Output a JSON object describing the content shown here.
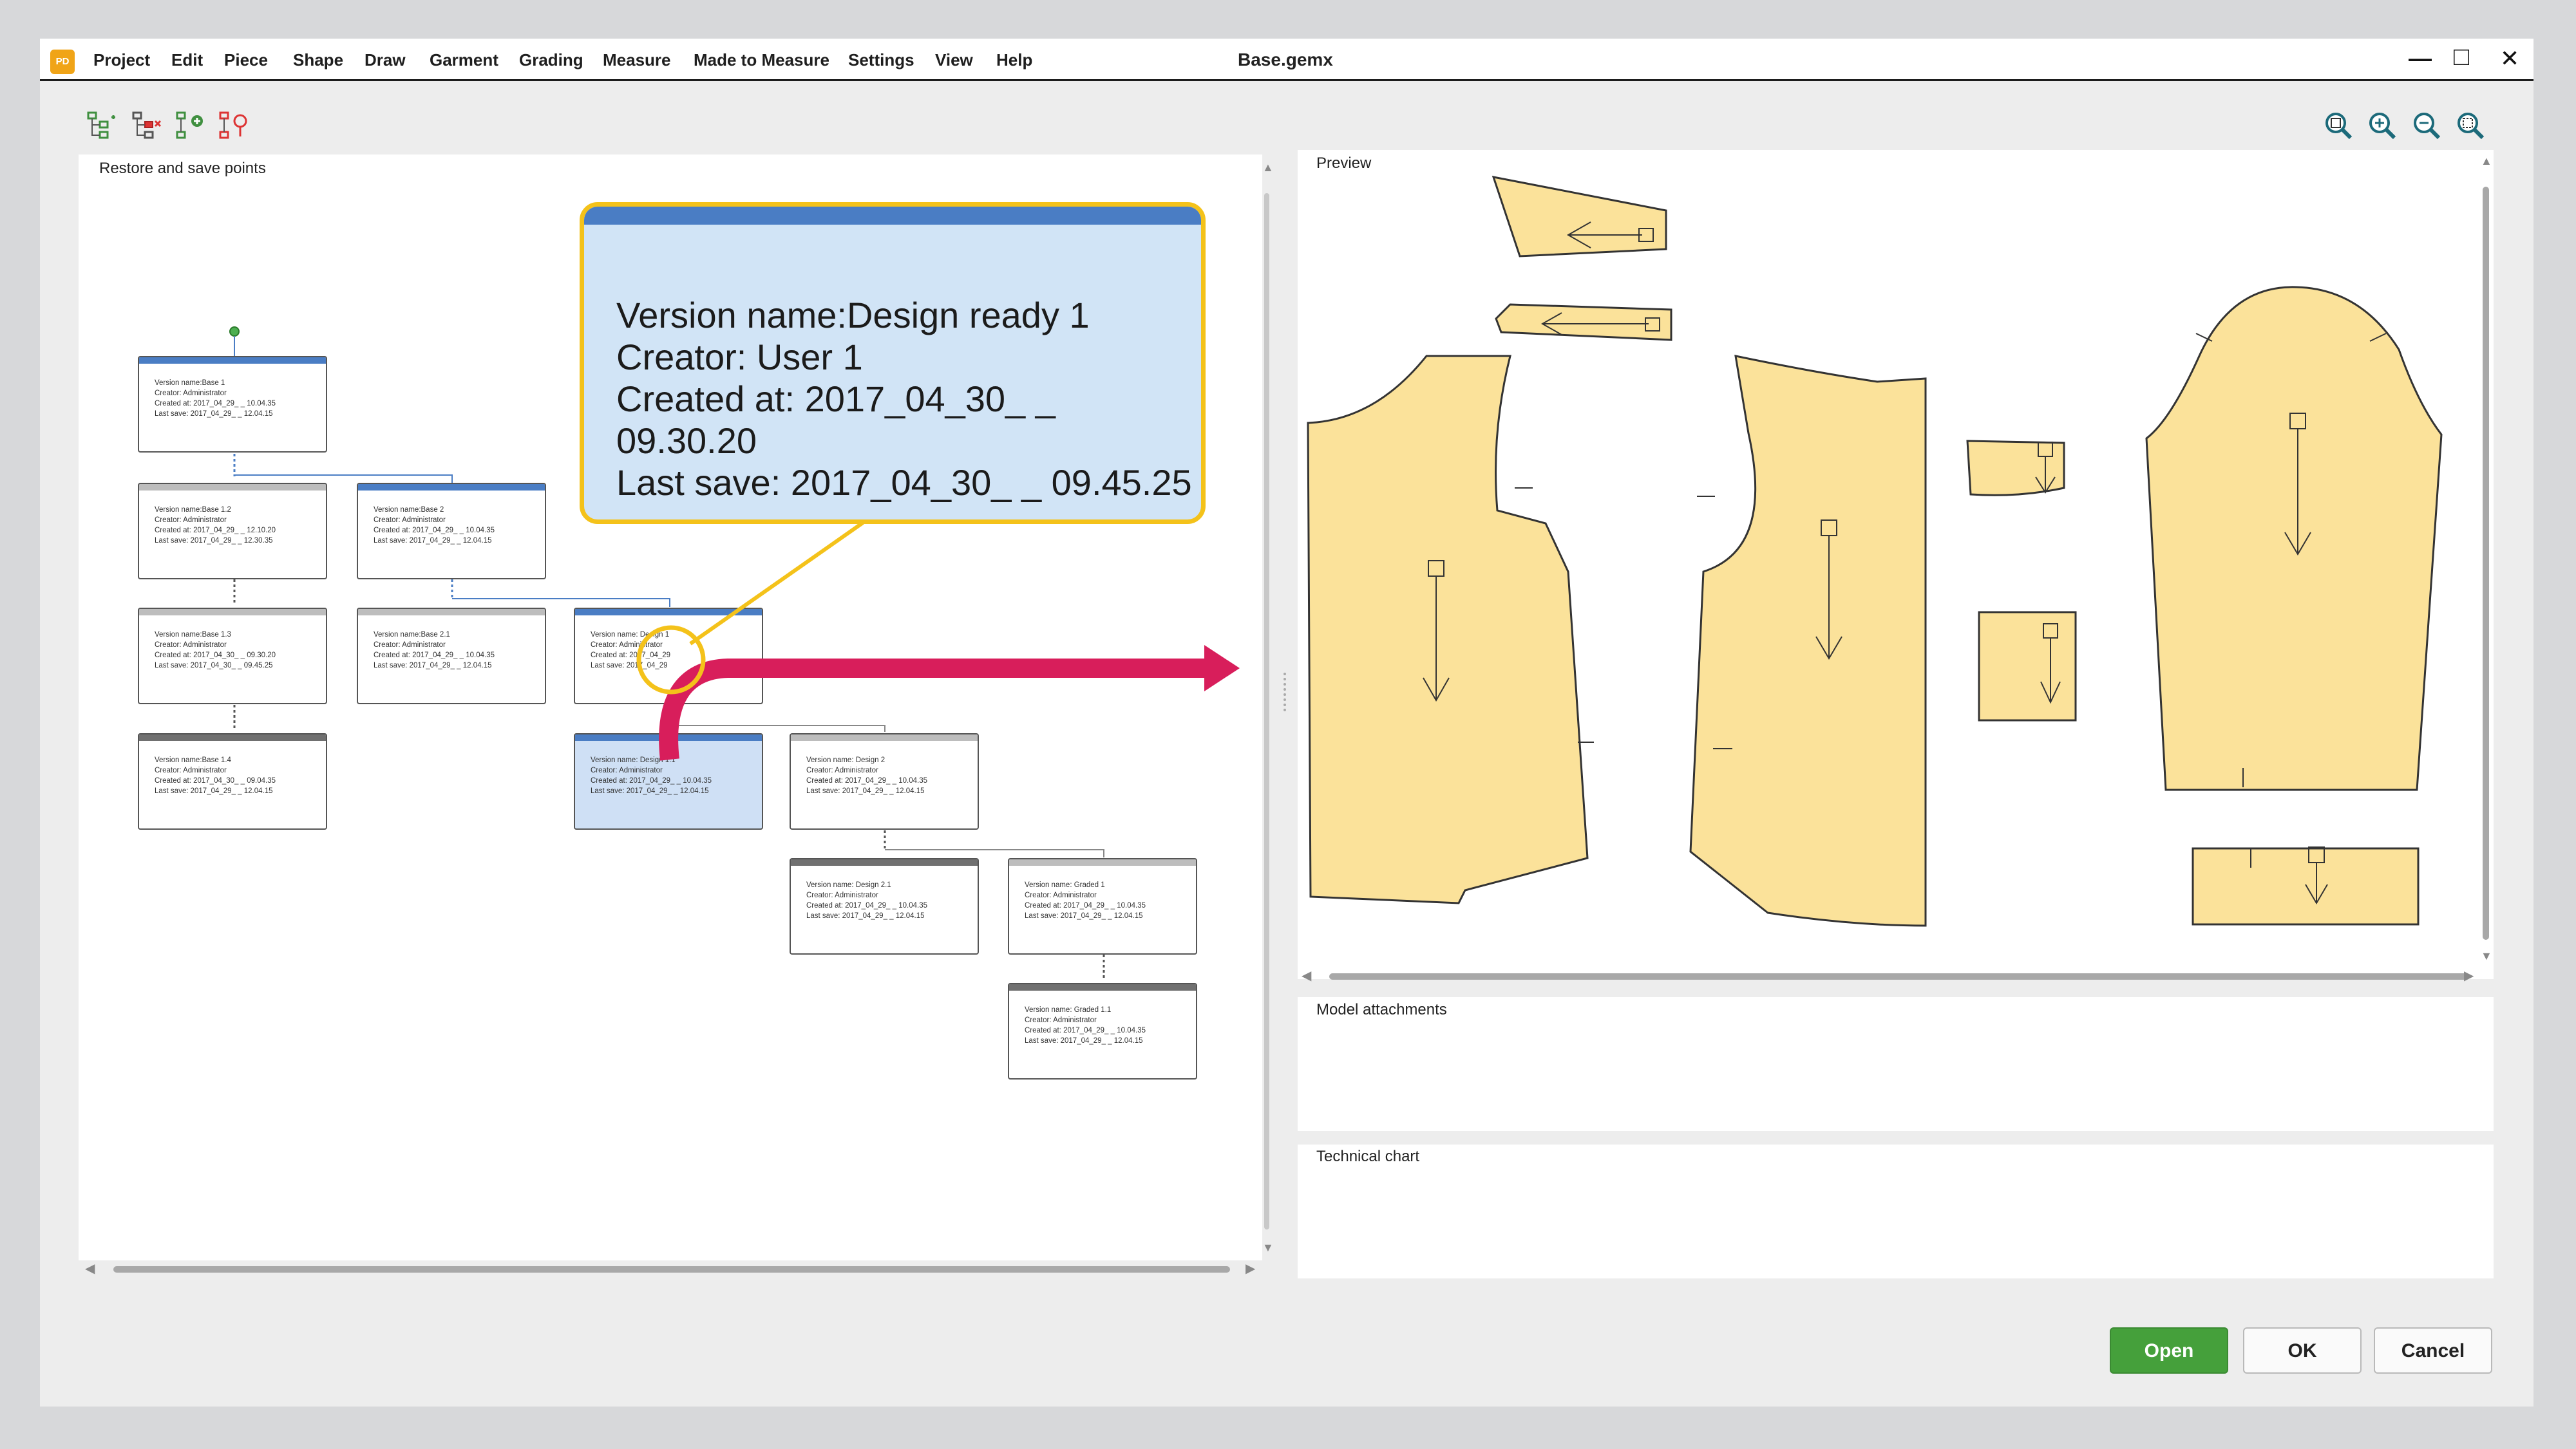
{
  "app": {
    "logo_text": "PD",
    "title": "Base.gemx"
  },
  "menu": [
    "Project",
    "Edit",
    "Piece",
    "Shape",
    "Draw",
    "Garment",
    "Grading",
    "Measure",
    "Made to Measure",
    "Settings",
    "View",
    "Help"
  ],
  "window_controls": {
    "minimize": "—",
    "maximize": "□",
    "close": "✕"
  },
  "toolbar_left_icons": [
    "tree-expand-icon",
    "tree-delete-icon",
    "tree-add-icon",
    "tree-restore-icon"
  ],
  "toolbar_right_icons": [
    "zoom-fit-icon",
    "zoom-in-icon",
    "zoom-out-icon",
    "zoom-selection-icon"
  ],
  "panels": {
    "restore": "Restore and save points",
    "preview": "Preview",
    "model_attachments": "Model attachments",
    "technical_chart": "Technical chart"
  },
  "nodes": [
    {
      "id": "base1",
      "style": "blue",
      "name": "Version name:Base 1",
      "creator": "Creator: Administrator",
      "created": "Created at: 2017_04_29_ _ 10.04.35",
      "saved": "Last save: 2017_04_29_ _ 12.04.15"
    },
    {
      "id": "base12",
      "style": "grey",
      "name": "Version name:Base 1.2",
      "creator": "Creator: Administrator",
      "created": "Created at: 2017_04_29_ _ 12.10.20",
      "saved": "Last save: 2017_04_29_ _ 12.30.35"
    },
    {
      "id": "base2",
      "style": "blue",
      "name": "Version name:Base 2",
      "creator": "Creator: Administrator",
      "created": "Created at: 2017_04_29_ _ 10.04.35",
      "saved": "Last save: 2017_04_29_ _ 12.04.15"
    },
    {
      "id": "base13",
      "style": "grey",
      "name": "Version name:Base 1.3",
      "creator": "Creator: Administrator",
      "created": "Created at: 2017_04_30_ _ 09.30.20",
      "saved": "Last save: 2017_04_30_ _ 09.45.25"
    },
    {
      "id": "base21",
      "style": "grey",
      "name": "Version name:Base 2.1",
      "creator": "Creator: Administrator",
      "created": "Created at: 2017_04_29_ _ 10.04.35",
      "saved": "Last save: 2017_04_29_ _ 12.04.15"
    },
    {
      "id": "design1",
      "style": "blue",
      "name": "Version name: Design 1",
      "creator": "Creator: Administrator",
      "created": "Created at: 2017_04_29",
      "saved": "Last save: 2017_04_29"
    },
    {
      "id": "base14",
      "style": "dark",
      "name": "Version name:Base 1.4",
      "creator": "Creator: Administrator",
      "created": "Created at: 2017_04_30_ _ 09.04.35",
      "saved": "Last save: 2017_04_29_ _ 12.04.15"
    },
    {
      "id": "design11",
      "style": "selected",
      "name": "Version name: Design 1.1",
      "creator": "Creator: Administrator",
      "created": "Created at: 2017_04_29_ _ 10.04.35",
      "saved": "Last save: 2017_04_29_ _ 12.04.15"
    },
    {
      "id": "design2",
      "style": "grey",
      "name": "Version name: Design 2",
      "creator": "Creator: Administrator",
      "created": "Created at: 2017_04_29_ _ 10.04.35",
      "saved": "Last save: 2017_04_29_ _ 12.04.15"
    },
    {
      "id": "design21",
      "style": "dark",
      "name": "Version name: Design 2.1",
      "creator": "Creator: Administrator",
      "created": "Created at: 2017_04_29_ _ 10.04.35",
      "saved": "Last save: 2017_04_29_ _ 12.04.15"
    },
    {
      "id": "graded1",
      "style": "grey",
      "name": "Version name: Graded 1",
      "creator": "Creator: Administrator",
      "created": "Created at: 2017_04_29_ _ 10.04.35",
      "saved": "Last save: 2017_04_29_ _ 12.04.15"
    },
    {
      "id": "graded11",
      "style": "dark",
      "name": "Version name: Graded 1.1",
      "creator": "Creator: Administrator",
      "created": "Created at: 2017_04_29_ _ 10.04.35",
      "saved": "Last save: 2017_04_29_ _ 12.04.15"
    }
  ],
  "callout": {
    "name": "Version name:Design ready 1",
    "creator": "Creator: User 1",
    "created": "Created at: 2017_04_30_ _ 09.30.20",
    "saved": "Last save: 2017_04_30_ _ 09.45.25"
  },
  "colors": {
    "accent_blue": "#4a7dc4",
    "callout_border": "#f4c21a",
    "arrow": "#d81e5b",
    "pattern_fill": "#fbe29a",
    "open_button": "#45a03b"
  },
  "buttons": {
    "open": "Open",
    "ok": "OK",
    "cancel": "Cancel"
  }
}
